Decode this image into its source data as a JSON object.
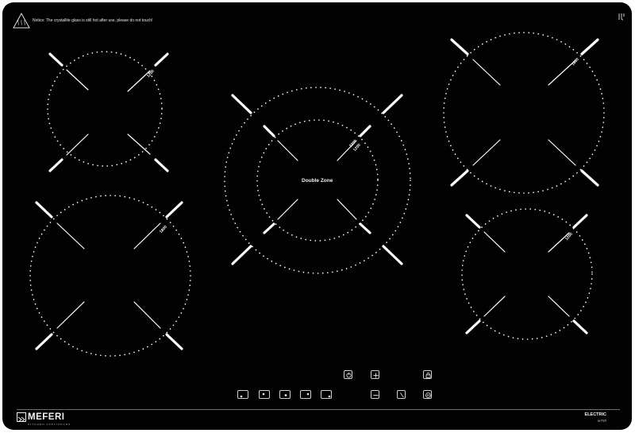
{
  "notice": {
    "text": "Notice: The crystallite glass is still hot after use, please do not touch!",
    "icon": "hot-surface-warning-icon"
  },
  "zones": {
    "top_left": {
      "rating": "1200"
    },
    "bottom_left": {
      "rating": "1800"
    },
    "center": {
      "label": "Double Zone",
      "rating_a": "2200",
      "rating_b": "1200"
    },
    "top_right": {
      "rating": "1800"
    },
    "bottom_right": {
      "rating": "1200"
    }
  },
  "controls": {
    "row1": [
      "power-icon",
      "plus-icon",
      "lock-icon"
    ],
    "row2": [
      "zone-1-icon",
      "zone-2-icon",
      "zone-3-icon",
      "zone-4-icon",
      "zone-5-icon",
      "minus-icon",
      "timer-icon",
      "pause-icon"
    ]
  },
  "brand": {
    "name": "MEFERI",
    "tagline": "KITCHEN APPLIANCES",
    "model_line1": "ELECTRIC",
    "model_line2": "ie75h"
  },
  "colors": {
    "glass": "#020202",
    "print": "#f2f2f2"
  }
}
